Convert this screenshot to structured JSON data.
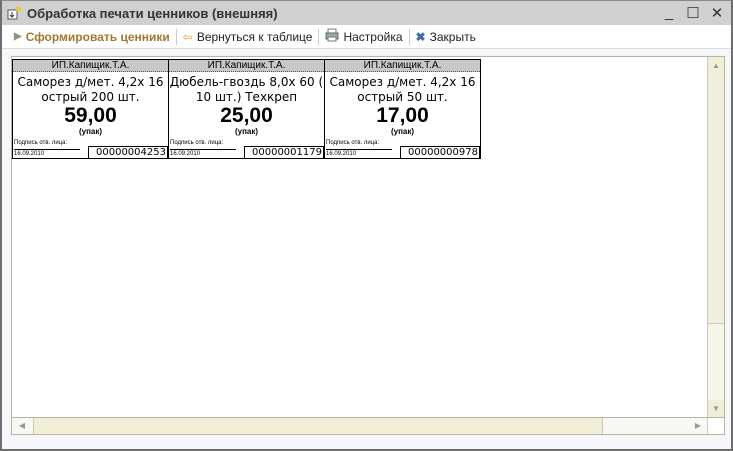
{
  "window": {
    "title": "Обработка печати ценников (внешняя)",
    "minimize": "_",
    "maximize": "☐",
    "close": "✕"
  },
  "toolbar": {
    "generate": "Сформировать ценники",
    "back": "Вернуться к таблице",
    "settings": "Настройка",
    "close": "Закрыть"
  },
  "tags": [
    {
      "seller": "ИП.Капищик.Т.А.",
      "name": "Саморез д/мет. 4,2х 16 острый 200 шт.",
      "price": "59,00",
      "unit": "(упак)",
      "signature": "Подпись отв. лица:",
      "date": "16.09.2010",
      "code": "00000004253"
    },
    {
      "seller": "ИП.Капищик.Т.А.",
      "name": "Дюбель-гвоздь  8,0х 60 ( 10 шт.) Техкреп",
      "price": "25,00",
      "unit": "(упак)",
      "signature": "Подпись отв. лица:",
      "date": "16.09.2010",
      "code": "00000001179"
    },
    {
      "seller": "ИП.Капищик.Т.А.",
      "name": "Саморез д/мет. 4,2х 16 острый  50 шт.",
      "price": "17,00",
      "unit": "(упак)",
      "signature": "Подпись отв. лица:",
      "date": "16.09.2010",
      "code": "00000000978"
    }
  ]
}
